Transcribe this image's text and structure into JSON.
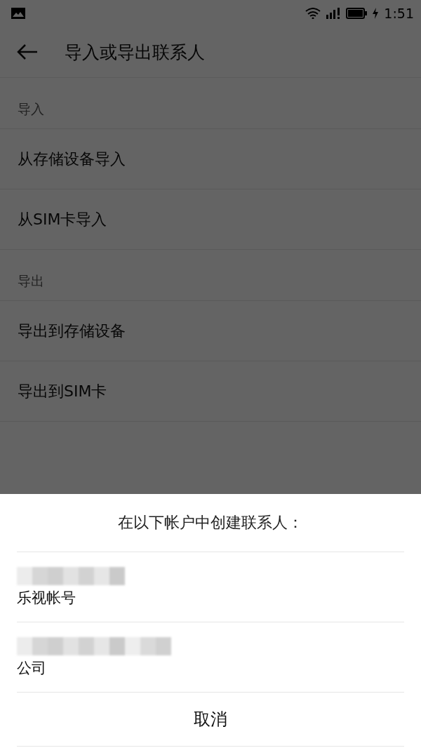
{
  "status_bar": {
    "time": "1:51"
  },
  "app_bar": {
    "title": "导入或导出联系人"
  },
  "sections": [
    {
      "header": "导入",
      "items": [
        "从存储设备导入",
        "从SIM卡导入"
      ]
    },
    {
      "header": "导出",
      "items": [
        "导出到存储设备",
        "导出到SIM卡"
      ]
    }
  ],
  "sheet": {
    "title": "在以下帐户中创建联系人：",
    "accounts": [
      {
        "type": "乐视帐号",
        "name_blurred": true
      },
      {
        "type": "公司",
        "name_blurred": true
      }
    ],
    "cancel": "取消"
  }
}
